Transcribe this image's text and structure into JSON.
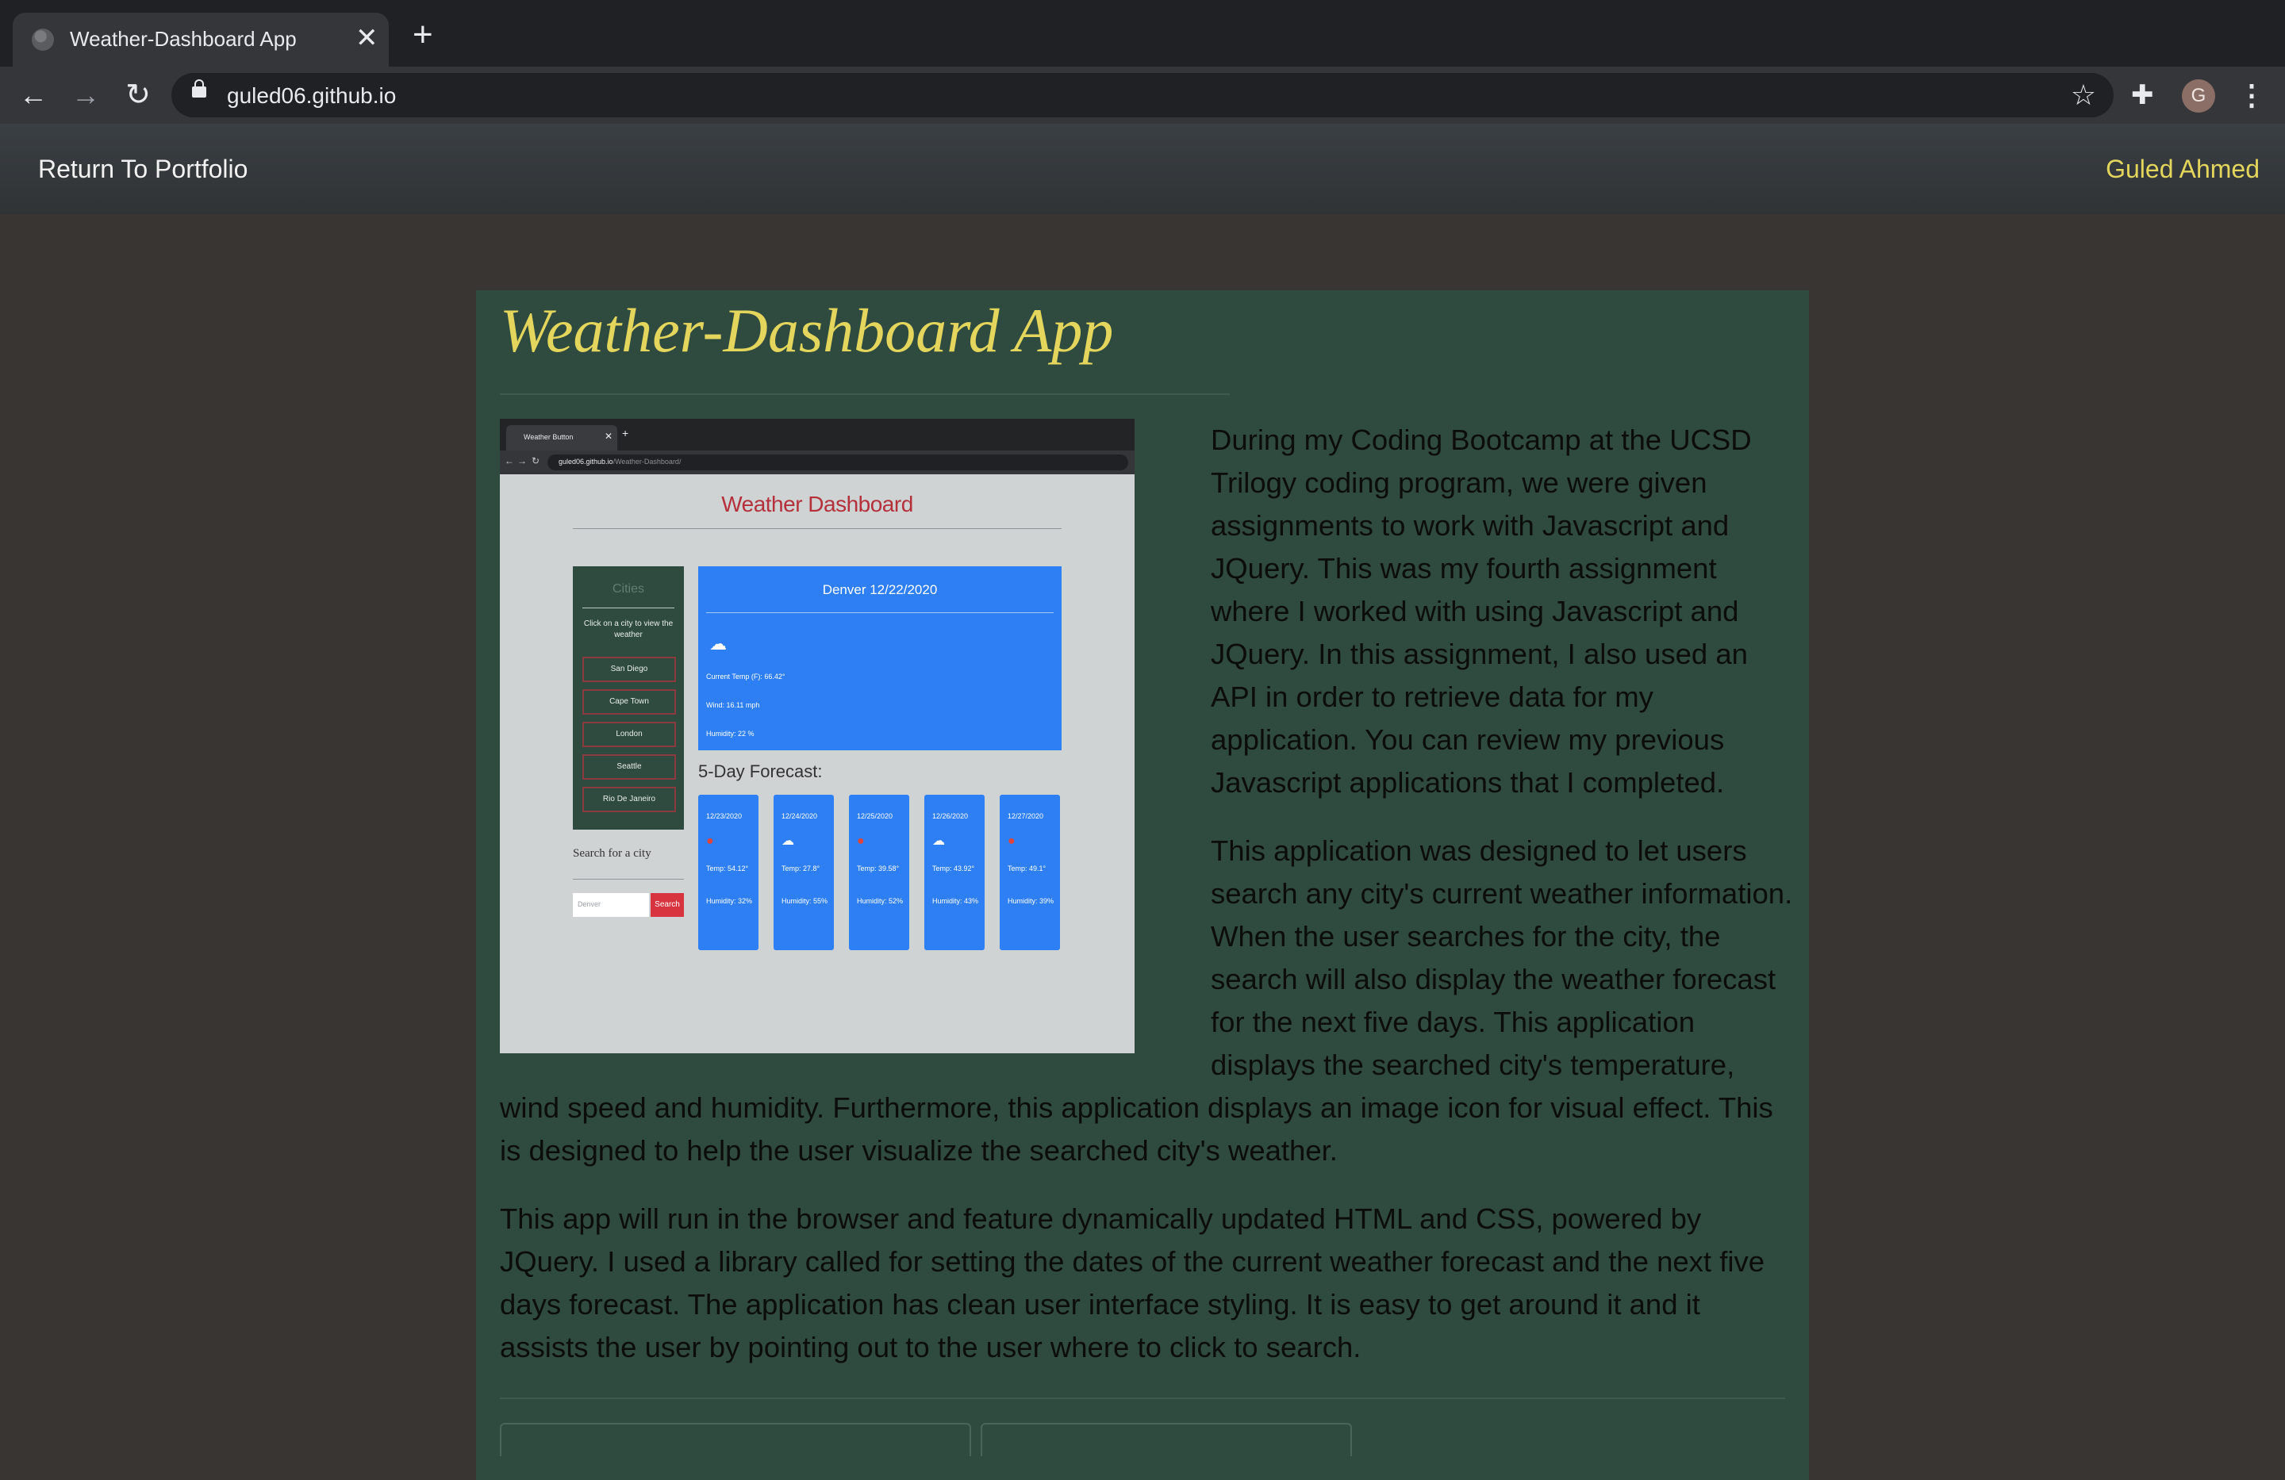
{
  "browser": {
    "tab_title": "Weather-Dashboard App",
    "tab_close": "✕",
    "new_tab": "+",
    "url": "guled06.github.io",
    "avatar_initial": "G",
    "icons": [
      "back-icon",
      "forward-icon",
      "reload-icon",
      "lock-icon",
      "star-icon",
      "extensions-icon",
      "menu-icon"
    ]
  },
  "navbar": {
    "return_label": "Return To Portfolio",
    "author": "Guled Ahmed",
    "author_color": "#e4d65c"
  },
  "project": {
    "title": "Weather-Dashboard App",
    "paragraphs": [
      "During my Coding Bootcamp at the UCSD Trilogy coding program, we were given assignments to work with Javascript and JQuery. This was my fourth assignment where I worked with using Javascript and JQuery. In this assignment, I also used an API in order to retrieve data for my application. You can review my previous Javascript applications that I completed.",
      "This application was designed to let users search any city's current weather information. When the user searches for the city, the search will also display the weather forecast for the next five days. This application displays the searched city's temperature, wind speed and humidity. Furthermore, this application displays an image icon for visual effect. This is designed to help the user visualize the searched city's weather.",
      "This app will run in the browser and feature dynamically updated HTML and CSS, powered by JQuery. I used a library called for setting the dates of the current weather forecast and the next five days forecast. The application has clean user interface styling. It is easy to get around it and it assists the user by pointing out to the user where to click to search."
    ]
  },
  "screenshot": {
    "tab_title": "Weather Button",
    "url_host": "guled06.github.io",
    "url_path": "/Weather-Dashboard/",
    "heading": "Weather Dashboard",
    "cities_title": "Cities",
    "cities_hint": "Click on a city to view the weather",
    "cities": [
      "San Diego",
      "Cape Town",
      "London",
      "Seattle",
      "Rio De Janeiro"
    ],
    "search_label": "Search for a city",
    "search_placeholder": "Denver",
    "search_button": "Search",
    "current": {
      "title": "Denver 12/22/2020",
      "temp": "Current Temp (F): 66.42°",
      "wind": "Wind: 16.11 mph",
      "humidity": "Humidity: 22 %"
    },
    "forecast_title": "5-Day Forecast:",
    "forecast": [
      {
        "date": "12/23/2020",
        "icon": "sun-icon",
        "temp": "Temp: 54.12°",
        "humidity": "Humidity: 32%"
      },
      {
        "date": "12/24/2020",
        "icon": "cloud-icon",
        "temp": "Temp: 27.8°",
        "humidity": "Humidity: 55%"
      },
      {
        "date": "12/25/2020",
        "icon": "sun-icon",
        "temp": "Temp: 39.58°",
        "humidity": "Humidity: 52%"
      },
      {
        "date": "12/26/2020",
        "icon": "cloud-icon",
        "temp": "Temp: 43.92°",
        "humidity": "Humidity: 43%"
      },
      {
        "date": "12/27/2020",
        "icon": "sun-icon",
        "temp": "Temp: 49.1°",
        "humidity": "Humidity: 39%"
      }
    ]
  }
}
